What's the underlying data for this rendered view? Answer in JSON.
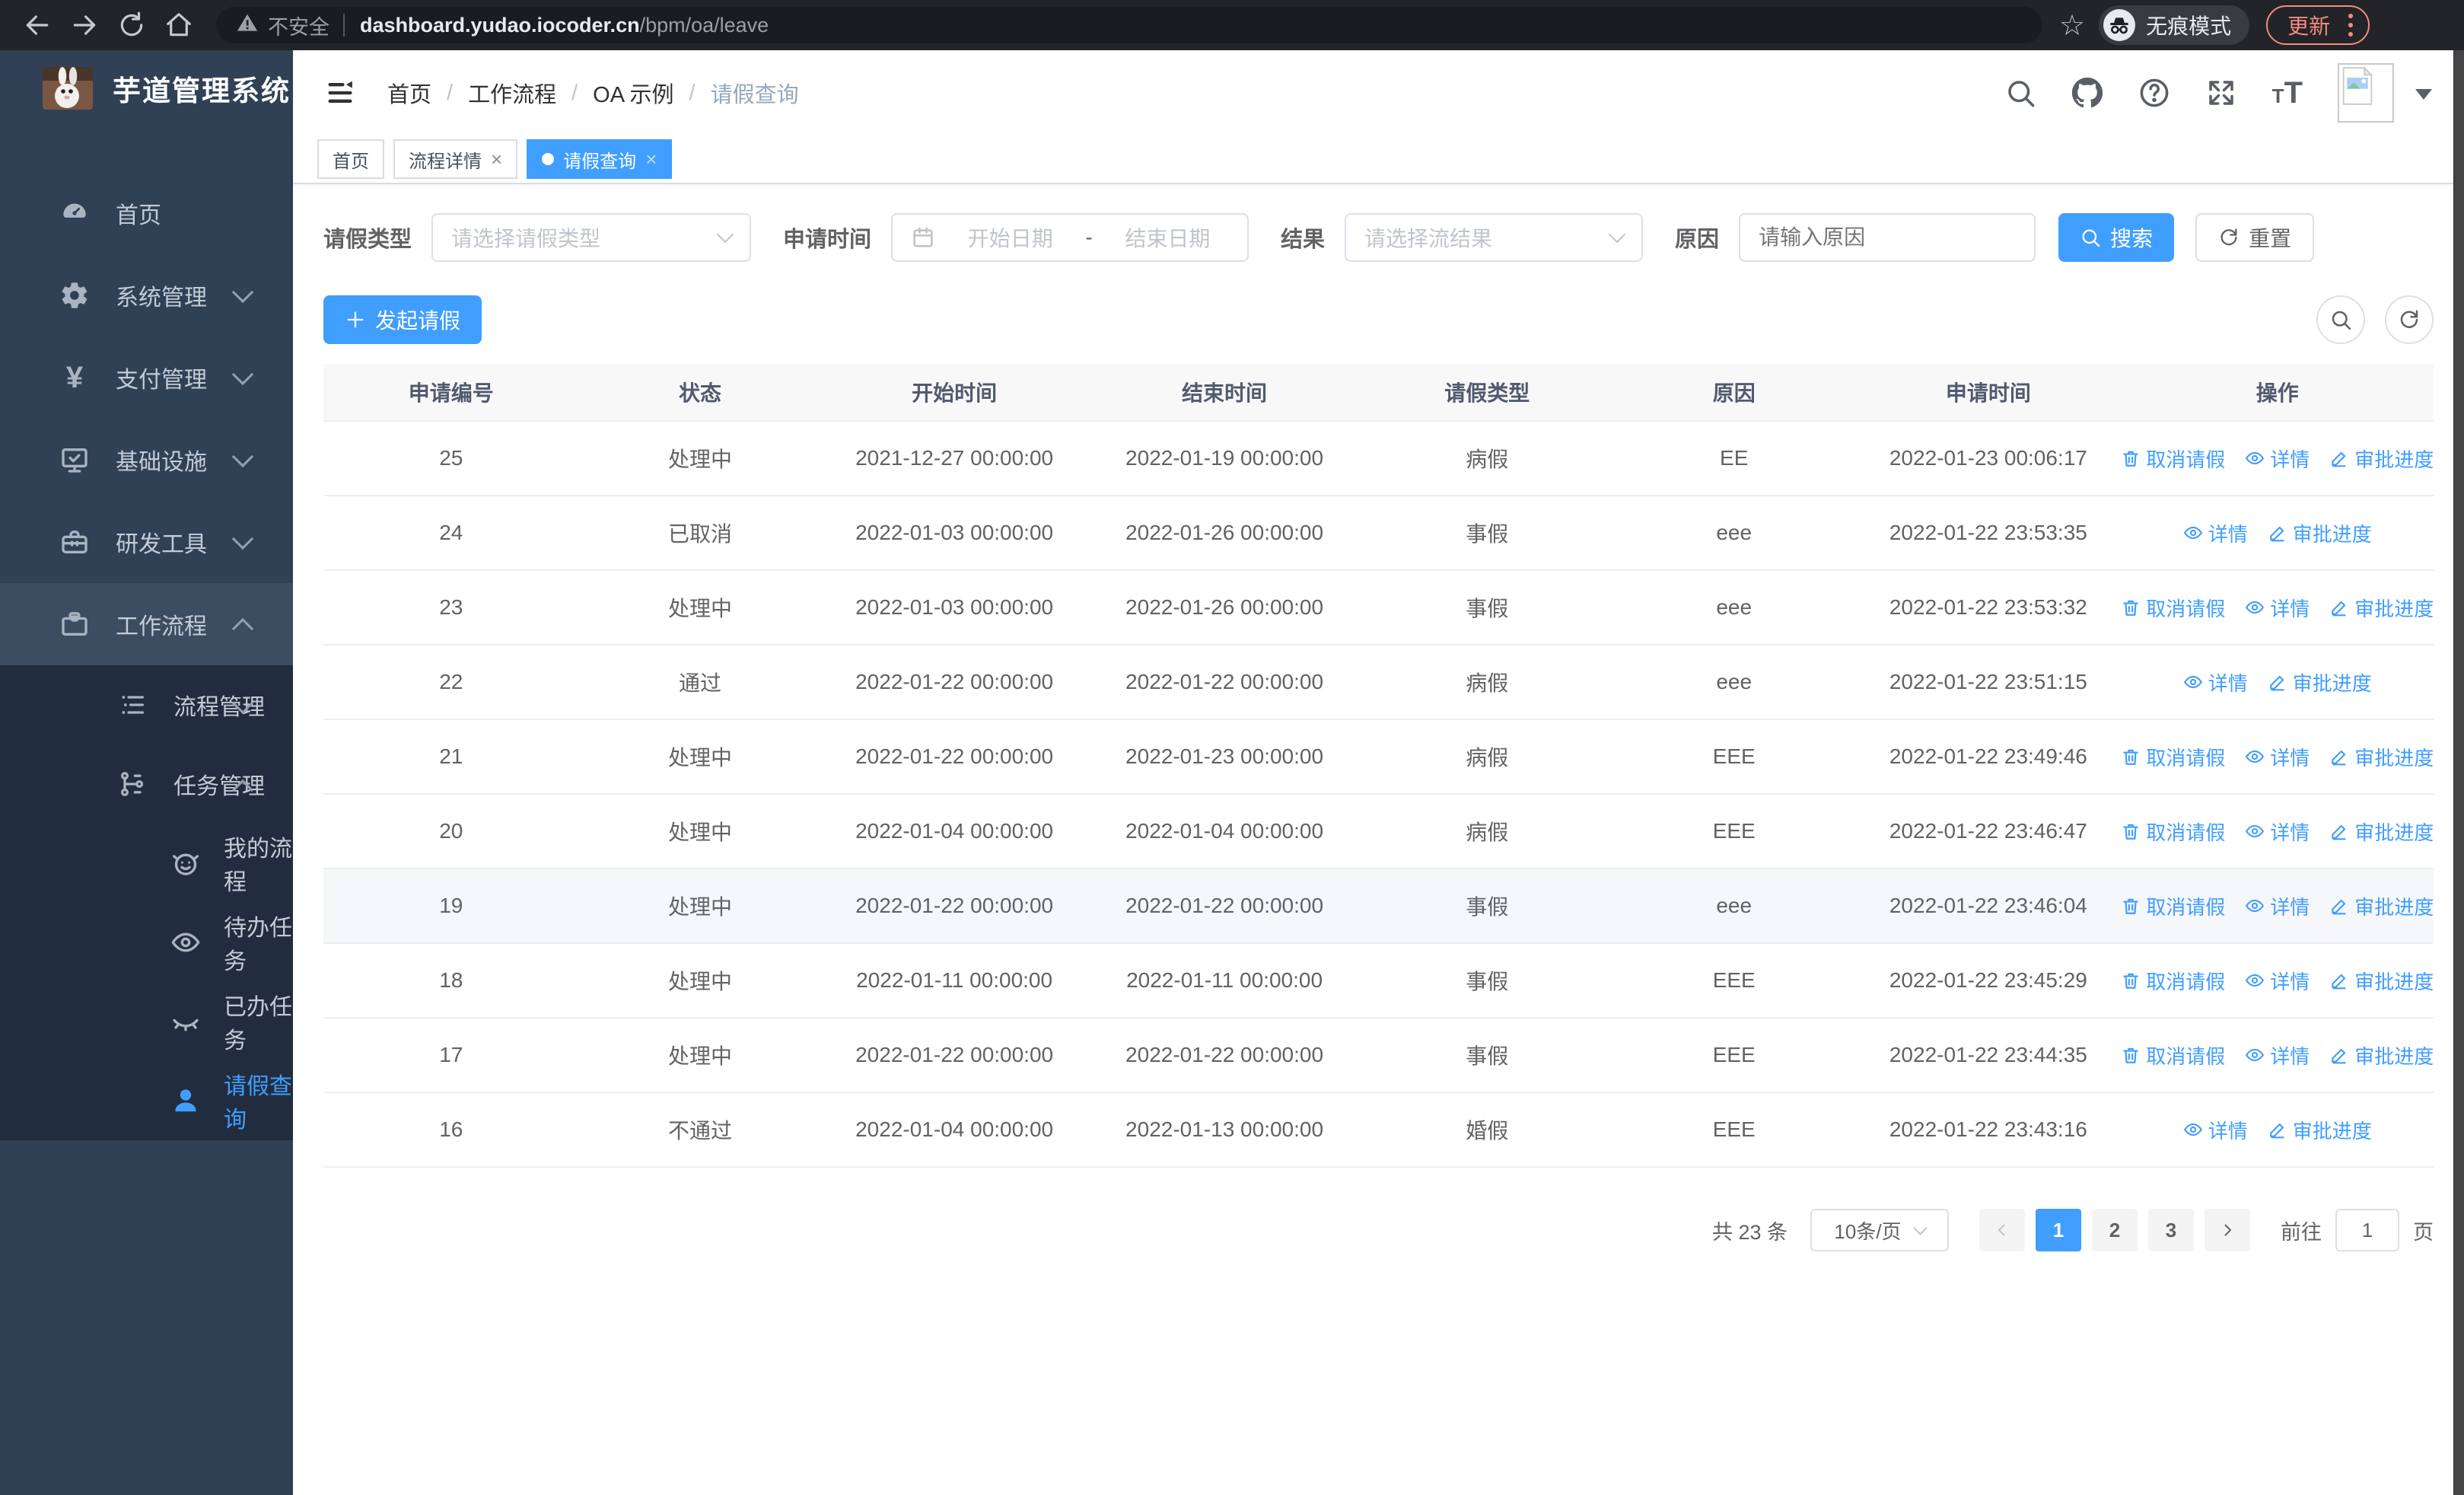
{
  "colors": {
    "primary": "#409eff",
    "sidebar_bg": "#304156",
    "submenu_bg": "#212d3e",
    "sidebar_text": "#c3cbd6",
    "update_accent": "#f28b82",
    "table_border": "#ebeef5",
    "header_bg": "#f8f8f9"
  },
  "browser": {
    "security_warning": "不安全",
    "url_host": "dashboard.yudao.iocoder.cn",
    "url_path": "/bpm/oa/leave",
    "incognito_label": "无痕模式",
    "update_label": "更新"
  },
  "sidebar": {
    "title": "芋道管理系统",
    "items": [
      {
        "label": "首页",
        "icon": "dashboard-icon",
        "level": 1
      },
      {
        "label": "系统管理",
        "icon": "gear-icon",
        "level": 1,
        "chevron": "down"
      },
      {
        "label": "支付管理",
        "icon": "yen-icon",
        "level": 1,
        "chevron": "down"
      },
      {
        "label": "基础设施",
        "icon": "monitor-icon",
        "level": 1,
        "chevron": "down"
      },
      {
        "label": "研发工具",
        "icon": "toolbox-icon",
        "level": 1,
        "chevron": "down"
      },
      {
        "label": "工作流程",
        "icon": "briefcase-icon",
        "level": 1,
        "chevron": "up",
        "parent_active": true
      },
      {
        "label": "流程管理",
        "icon": "list-icon",
        "level": 2,
        "chevron": "down",
        "in_submenu": true
      },
      {
        "label": "任务管理",
        "icon": "flow-icon",
        "level": 2,
        "chevron": "up",
        "in_submenu": true
      },
      {
        "label": "我的流程",
        "icon": "face-icon",
        "level": 3,
        "in_submenu": true
      },
      {
        "label": "待办任务",
        "icon": "eye-icon",
        "level": 3,
        "in_submenu": true
      },
      {
        "label": "已办任务",
        "icon": "eye-closed-icon",
        "level": 3,
        "in_submenu": true
      },
      {
        "label": "请假查询",
        "icon": "user-icon",
        "level": 3,
        "in_submenu": true,
        "active": true
      }
    ]
  },
  "header": {
    "breadcrumb": [
      "首页",
      "工作流程",
      "OA 示例",
      "请假查询"
    ],
    "icons": [
      "search-icon",
      "github-icon",
      "help-icon",
      "fullscreen-icon",
      "font-size-icon"
    ]
  },
  "tabs": [
    {
      "label": "首页",
      "closable": false,
      "active": false
    },
    {
      "label": "流程详情",
      "closable": true,
      "active": false
    },
    {
      "label": "请假查询",
      "closable": true,
      "active": true
    }
  ],
  "filters": {
    "leave_type": {
      "label": "请假类型",
      "placeholder": "请选择请假类型"
    },
    "apply_time": {
      "label": "申请时间",
      "start_placeholder": "开始日期",
      "separator": "-",
      "end_placeholder": "结束日期"
    },
    "result": {
      "label": "结果",
      "placeholder": "请选择流结果"
    },
    "reason": {
      "label": "原因",
      "placeholder": "请输入原因"
    },
    "search_label": "搜索",
    "reset_label": "重置"
  },
  "toolbar": {
    "create_label": "发起请假"
  },
  "table": {
    "headers": [
      "申请编号",
      "状态",
      "开始时间",
      "结束时间",
      "请假类型",
      "原因",
      "申请时间",
      "操作"
    ],
    "action_labels": {
      "cancel": "取消请假",
      "detail": "详情",
      "progress": "审批进度"
    },
    "rows": [
      {
        "id": "25",
        "status": "处理中",
        "start": "2021-12-27 00:00:00",
        "end": "2022-01-19 00:00:00",
        "type": "病假",
        "reason": "EE",
        "apply_time": "2022-01-23 00:06:17",
        "actions": [
          "cancel",
          "detail",
          "progress"
        ]
      },
      {
        "id": "24",
        "status": "已取消",
        "start": "2022-01-03 00:00:00",
        "end": "2022-01-26 00:00:00",
        "type": "事假",
        "reason": "eee",
        "apply_time": "2022-01-22 23:53:35",
        "actions": [
          "detail",
          "progress"
        ]
      },
      {
        "id": "23",
        "status": "处理中",
        "start": "2022-01-03 00:00:00",
        "end": "2022-01-26 00:00:00",
        "type": "事假",
        "reason": "eee",
        "apply_time": "2022-01-22 23:53:32",
        "actions": [
          "cancel",
          "detail",
          "progress"
        ]
      },
      {
        "id": "22",
        "status": "通过",
        "start": "2022-01-22 00:00:00",
        "end": "2022-01-22 00:00:00",
        "type": "病假",
        "reason": "eee",
        "apply_time": "2022-01-22 23:51:15",
        "actions": [
          "detail",
          "progress"
        ]
      },
      {
        "id": "21",
        "status": "处理中",
        "start": "2022-01-22 00:00:00",
        "end": "2022-01-23 00:00:00",
        "type": "病假",
        "reason": "EEE",
        "apply_time": "2022-01-22 23:49:46",
        "actions": [
          "cancel",
          "detail",
          "progress"
        ]
      },
      {
        "id": "20",
        "status": "处理中",
        "start": "2022-01-04 00:00:00",
        "end": "2022-01-04 00:00:00",
        "type": "病假",
        "reason": "EEE",
        "apply_time": "2022-01-22 23:46:47",
        "actions": [
          "cancel",
          "detail",
          "progress"
        ]
      },
      {
        "id": "19",
        "status": "处理中",
        "start": "2022-01-22 00:00:00",
        "end": "2022-01-22 00:00:00",
        "type": "事假",
        "reason": "eee",
        "apply_time": "2022-01-22 23:46:04",
        "actions": [
          "cancel",
          "detail",
          "progress"
        ],
        "hovered": true
      },
      {
        "id": "18",
        "status": "处理中",
        "start": "2022-01-11 00:00:00",
        "end": "2022-01-11 00:00:00",
        "type": "事假",
        "reason": "EEE",
        "apply_time": "2022-01-22 23:45:29",
        "actions": [
          "cancel",
          "detail",
          "progress"
        ]
      },
      {
        "id": "17",
        "status": "处理中",
        "start": "2022-01-22 00:00:00",
        "end": "2022-01-22 00:00:00",
        "type": "事假",
        "reason": "EEE",
        "apply_time": "2022-01-22 23:44:35",
        "actions": [
          "cancel",
          "detail",
          "progress"
        ]
      },
      {
        "id": "16",
        "status": "不通过",
        "start": "2022-01-04 00:00:00",
        "end": "2022-01-13 00:00:00",
        "type": "婚假",
        "reason": "EEE",
        "apply_time": "2022-01-22 23:43:16",
        "actions": [
          "detail",
          "progress"
        ]
      }
    ]
  },
  "pagination": {
    "total_label": "共 23 条",
    "page_size": "10条/页",
    "pages": [
      "1",
      "2",
      "3"
    ],
    "active_page": "1",
    "goto_label": "前往",
    "goto_value": "1",
    "goto_suffix": "页"
  }
}
